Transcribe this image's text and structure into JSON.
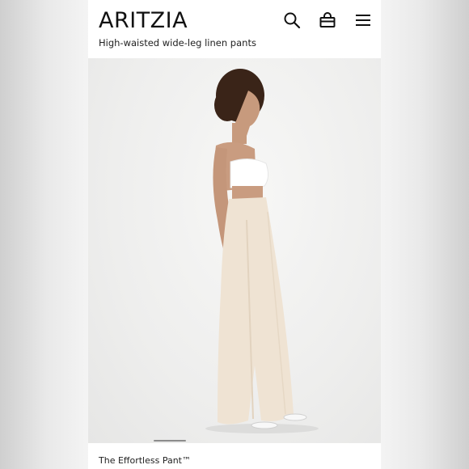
{
  "header": {
    "brand": "ARITZIA",
    "subtitle": "High-waisted wide-leg linen pants",
    "icons": [
      "search-icon",
      "bag-icon",
      "menu-icon"
    ]
  },
  "product": {
    "image_alt": "Model wearing high-waisted wide-leg linen pants",
    "carousel_active_index": 1,
    "name": "The Effortless Pant™"
  },
  "colors": {
    "page_bg": "#f4f4f4",
    "panel_bg": "#ffffff",
    "pant": "#efe3d3",
    "text": "#111111"
  }
}
